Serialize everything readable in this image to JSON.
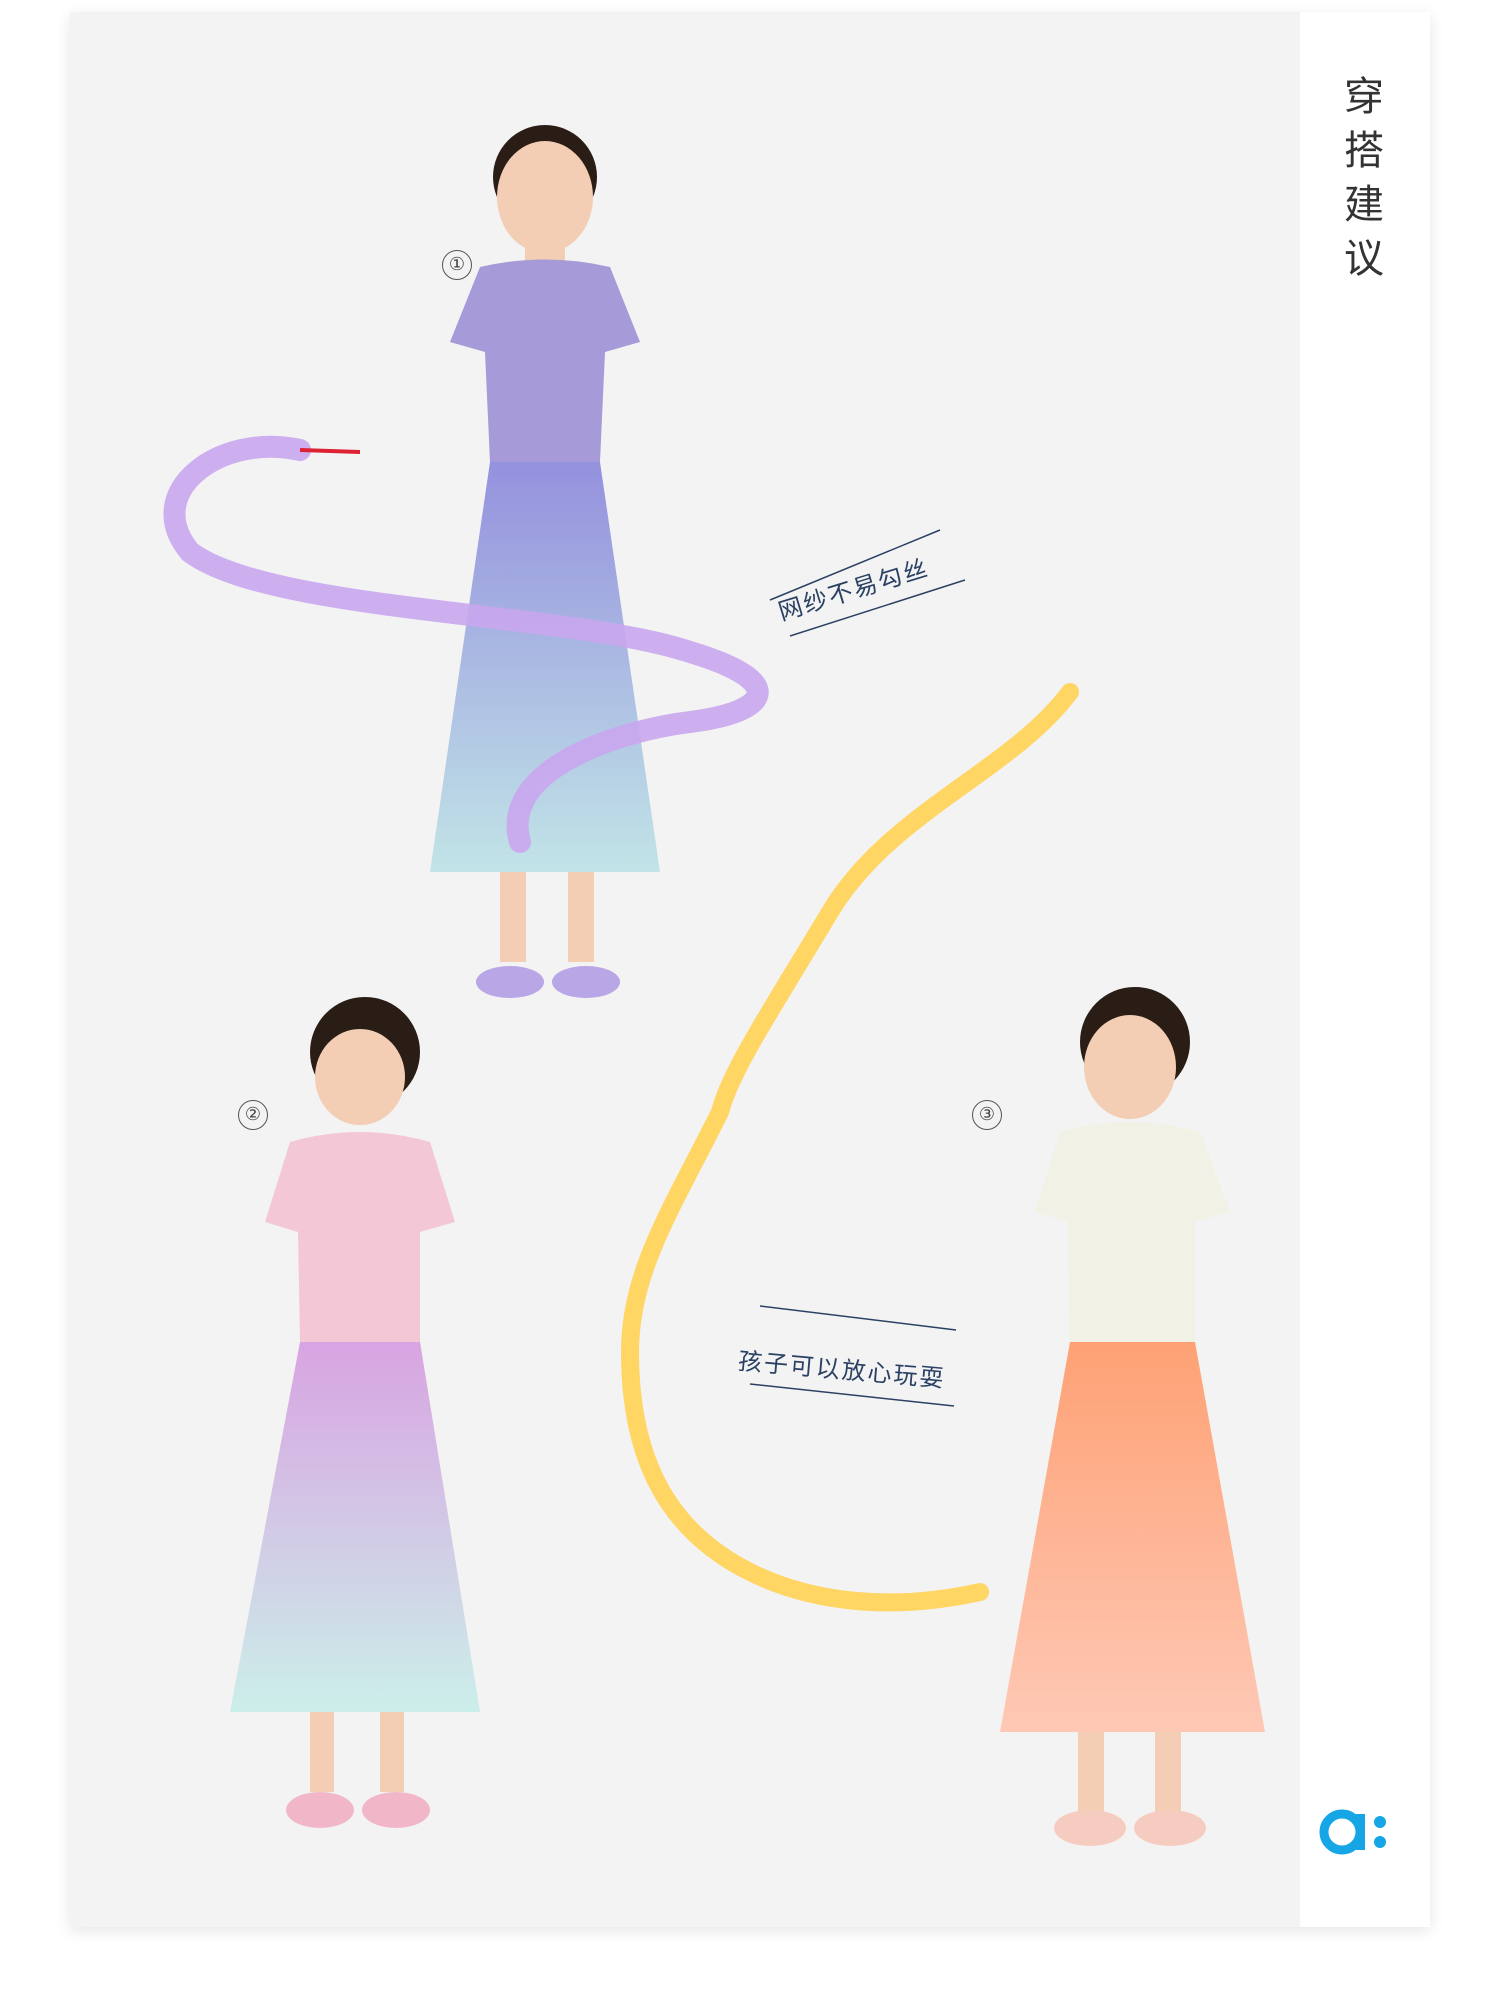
{
  "sidebar": {
    "title": "穿搭建议"
  },
  "logo": {
    "text": "a:",
    "color": "#16a6e6"
  },
  "outfits": [
    {
      "index": "①",
      "top_color": "#a69ad8",
      "skirt_top": "#8c88dc",
      "skirt_bottom": "#bde3e6",
      "shoe_color": "#b8a6e6",
      "hair_color": "#2a1d16"
    },
    {
      "index": "②",
      "top_color": "#f4c7d6",
      "skirt_top": "#d59be0",
      "skirt_bottom": "#c7eee8",
      "shoe_color": "#f1b7c9",
      "hair_color": "#2a1d16"
    },
    {
      "index": "③",
      "top_color": "#f2f1e6",
      "skirt_top": "#ff9a6a",
      "skirt_bottom": "#ffc5b0",
      "shoe_color": "#f6ccc0",
      "hair_color": "#2a1d16"
    }
  ],
  "callouts": [
    {
      "text": "网纱不易勾丝"
    },
    {
      "text": "孩子可以放心玩耍"
    }
  ],
  "ribbons": [
    {
      "name": "purple-ribbon",
      "color": "#c9a6ee"
    },
    {
      "name": "yellow-ribbon",
      "color": "#ffd35c"
    }
  ]
}
